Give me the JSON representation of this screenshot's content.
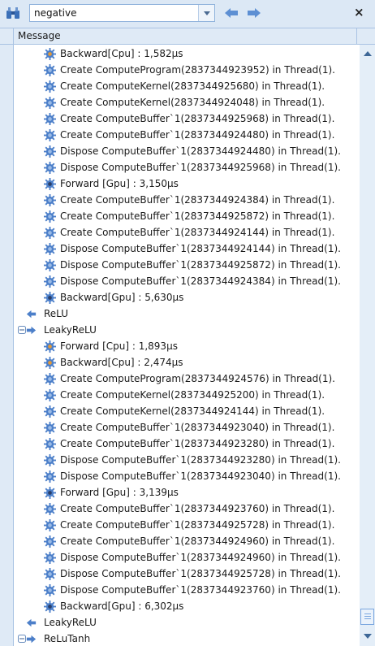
{
  "toolbar": {
    "search_value": "negative",
    "search_placeholder": "",
    "find_icon": "binoculars-icon",
    "back_icon": "arrow-left-icon",
    "forward_icon": "arrow-right-icon",
    "close_label": "×"
  },
  "header": {
    "column": "Message"
  },
  "colors": {
    "accent": "#4a7fc8",
    "background": "#dfeaf6",
    "border": "#a9c3e3"
  },
  "rows": [
    {
      "level": 1,
      "icon": "gear-cpu",
      "text": "Backward[Cpu] : 1,582µs"
    },
    {
      "level": 1,
      "icon": "gear",
      "text": "Create ComputeProgram(2837344923952) in Thread(1)."
    },
    {
      "level": 1,
      "icon": "gear",
      "text": "Create ComputeKernel(2837344925680) in Thread(1)."
    },
    {
      "level": 1,
      "icon": "gear",
      "text": "Create ComputeKernel(2837344924048) in Thread(1)."
    },
    {
      "level": 1,
      "icon": "gear",
      "text": "Create ComputeBuffer`1(2837344925968) in Thread(1)."
    },
    {
      "level": 1,
      "icon": "gear",
      "text": "Create ComputeBuffer`1(2837344924480) in Thread(1)."
    },
    {
      "level": 1,
      "icon": "gear",
      "text": "Dispose ComputeBuffer`1(2837344924480) in Thread(1)."
    },
    {
      "level": 1,
      "icon": "gear",
      "text": "Dispose ComputeBuffer`1(2837344925968) in Thread(1)."
    },
    {
      "level": 1,
      "icon": "gear-gpu",
      "text": "Forward [Gpu] : 3,150µs"
    },
    {
      "level": 1,
      "icon": "gear",
      "text": "Create ComputeBuffer`1(2837344924384) in Thread(1)."
    },
    {
      "level": 1,
      "icon": "gear",
      "text": "Create ComputeBuffer`1(2837344925872) in Thread(1)."
    },
    {
      "level": 1,
      "icon": "gear",
      "text": "Create ComputeBuffer`1(2837344924144) in Thread(1)."
    },
    {
      "level": 1,
      "icon": "gear",
      "text": "Dispose ComputeBuffer`1(2837344924144) in Thread(1)."
    },
    {
      "level": 1,
      "icon": "gear",
      "text": "Dispose ComputeBuffer`1(2837344925872) in Thread(1)."
    },
    {
      "level": 1,
      "icon": "gear",
      "text": "Dispose ComputeBuffer`1(2837344924384) in Thread(1)."
    },
    {
      "level": 1,
      "icon": "gear-gpu",
      "text": "Backward[Gpu] : 5,630µs"
    },
    {
      "level": 0,
      "icon": "arrow-left",
      "text": "ReLU"
    },
    {
      "level": 0,
      "icon": "arrow-right",
      "text": "LeakyReLU",
      "expander": "collapse"
    },
    {
      "level": 1,
      "icon": "gear-cpu",
      "text": "Forward [Cpu] : 1,893µs"
    },
    {
      "level": 1,
      "icon": "gear-cpu",
      "text": "Backward[Cpu] : 2,474µs"
    },
    {
      "level": 1,
      "icon": "gear",
      "text": "Create ComputeProgram(2837344924576) in Thread(1)."
    },
    {
      "level": 1,
      "icon": "gear",
      "text": "Create ComputeKernel(2837344925200) in Thread(1)."
    },
    {
      "level": 1,
      "icon": "gear",
      "text": "Create ComputeKernel(2837344924144) in Thread(1)."
    },
    {
      "level": 1,
      "icon": "gear",
      "text": "Create ComputeBuffer`1(2837344923040) in Thread(1)."
    },
    {
      "level": 1,
      "icon": "gear",
      "text": "Create ComputeBuffer`1(2837344923280) in Thread(1)."
    },
    {
      "level": 1,
      "icon": "gear",
      "text": "Dispose ComputeBuffer`1(2837344923280) in Thread(1)."
    },
    {
      "level": 1,
      "icon": "gear",
      "text": "Dispose ComputeBuffer`1(2837344923040) in Thread(1)."
    },
    {
      "level": 1,
      "icon": "gear-gpu",
      "text": "Forward [Gpu] : 3,139µs"
    },
    {
      "level": 1,
      "icon": "gear",
      "text": "Create ComputeBuffer`1(2837344923760) in Thread(1)."
    },
    {
      "level": 1,
      "icon": "gear",
      "text": "Create ComputeBuffer`1(2837344925728) in Thread(1)."
    },
    {
      "level": 1,
      "icon": "gear",
      "text": "Create ComputeBuffer`1(2837344924960) in Thread(1)."
    },
    {
      "level": 1,
      "icon": "gear",
      "text": "Dispose ComputeBuffer`1(2837344924960) in Thread(1)."
    },
    {
      "level": 1,
      "icon": "gear",
      "text": "Dispose ComputeBuffer`1(2837344925728) in Thread(1)."
    },
    {
      "level": 1,
      "icon": "gear",
      "text": "Dispose ComputeBuffer`1(2837344923760) in Thread(1)."
    },
    {
      "level": 1,
      "icon": "gear-gpu",
      "text": "Backward[Gpu] : 6,302µs"
    },
    {
      "level": 0,
      "icon": "arrow-left",
      "text": "LeakyReLU"
    },
    {
      "level": 0,
      "icon": "arrow-right",
      "text": "ReLuTanh",
      "expander": "collapse"
    }
  ],
  "scrollbar": {
    "position_fraction": 0.97
  }
}
